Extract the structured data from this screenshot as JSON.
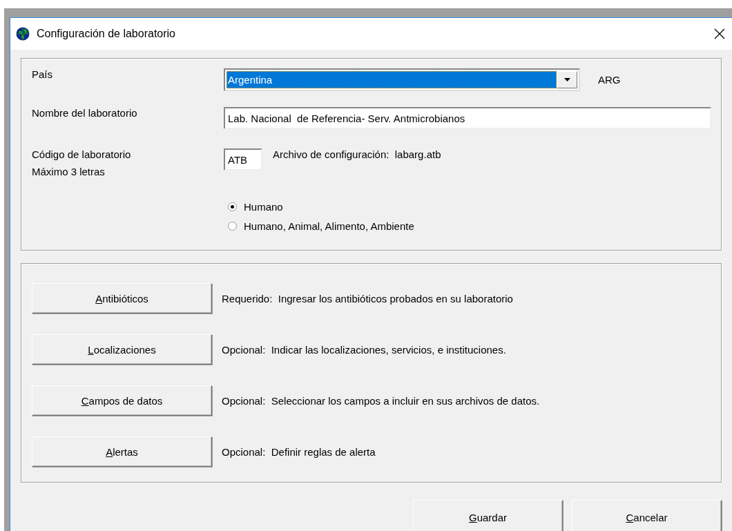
{
  "window": {
    "title": "Configuración de laboratorio"
  },
  "country": {
    "label": "País",
    "value": "Argentina",
    "code": "ARG"
  },
  "lab_name": {
    "label": "Nombre del laboratorio",
    "value": "Lab. Nacional  de Referencia- Serv. Antmicrobianos"
  },
  "lab_code": {
    "label": "Código de laboratorio",
    "hint": "Máximo 3 letras",
    "value": "ATB",
    "file_label": "Archivo de configuración:",
    "file_name": "labarg.atb"
  },
  "scope_options": [
    {
      "label": "Humano",
      "selected": true
    },
    {
      "label": "Humano, Animal, Alimento, Ambiente",
      "selected": false
    }
  ],
  "actions": [
    {
      "button": "Antibióticos",
      "description": "Requerido:  Ingresar los antibióticos probados en su laboratorio"
    },
    {
      "button": "Localizaciones",
      "description": "Opcional:  Indicar las localizaciones, servicios, e instituciones."
    },
    {
      "button": "Campos de datos",
      "description": "Opcional:  Seleccionar los campos a incluir en sus archivos de datos."
    },
    {
      "button": "Alertas",
      "description": "Opcional:  Definir reglas de alerta"
    }
  ],
  "buttons": [
    "Guardar",
    "Cancelar"
  ]
}
